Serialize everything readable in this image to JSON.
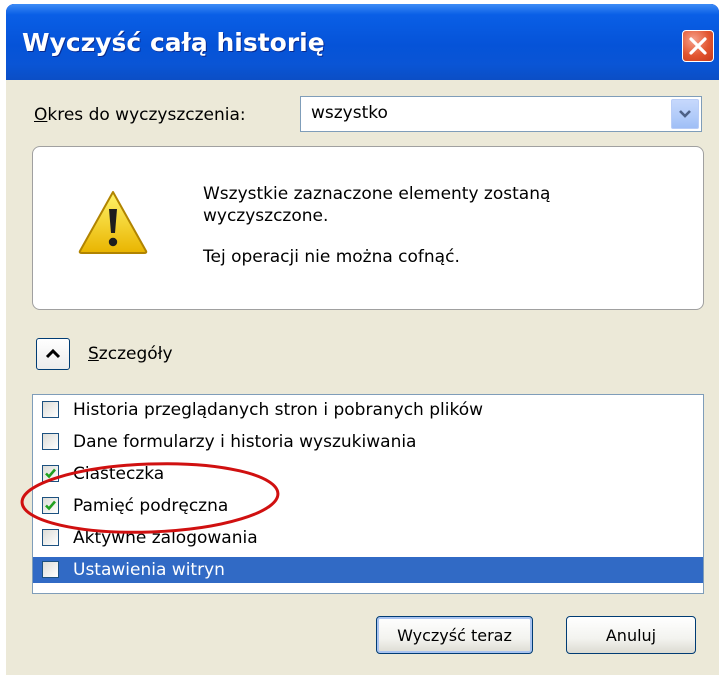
{
  "window": {
    "title": "Wyczyść całą historię"
  },
  "period": {
    "label_accel": "O",
    "label_rest": "kres do wyczyszczenia:",
    "selected": "wszystko"
  },
  "warning": {
    "line1": "Wszystkie zaznaczone elementy zostaną wyczyszczone.",
    "line2": "Tej operacji nie można cofnąć."
  },
  "details": {
    "label_accel": "S",
    "label_rest": "zczegóły",
    "items": [
      {
        "label": "Historia przeglądanych stron i pobranych plików",
        "checked": false,
        "selected": false
      },
      {
        "label": "Dane formularzy i historia wyszukiwania",
        "checked": false,
        "selected": false
      },
      {
        "label": "Ciasteczka",
        "checked": true,
        "selected": false
      },
      {
        "label": "Pamięć podręczna",
        "checked": true,
        "selected": false
      },
      {
        "label": "Aktywne zalogowania",
        "checked": false,
        "selected": false
      },
      {
        "label": "Ustawienia witryn",
        "checked": false,
        "selected": true
      }
    ]
  },
  "buttons": {
    "clear_now": "Wyczyść teraz",
    "cancel": "Anuluj"
  },
  "colors": {
    "titlebar": "#0553d8",
    "selection": "#316ac5",
    "annotation": "#d01010",
    "check": "#21a121"
  },
  "icons": {
    "close": "close-icon",
    "warning": "warning-icon",
    "dropdown": "chevron-down-icon",
    "collapse": "chevron-up-icon",
    "check": "checkmark-icon"
  }
}
